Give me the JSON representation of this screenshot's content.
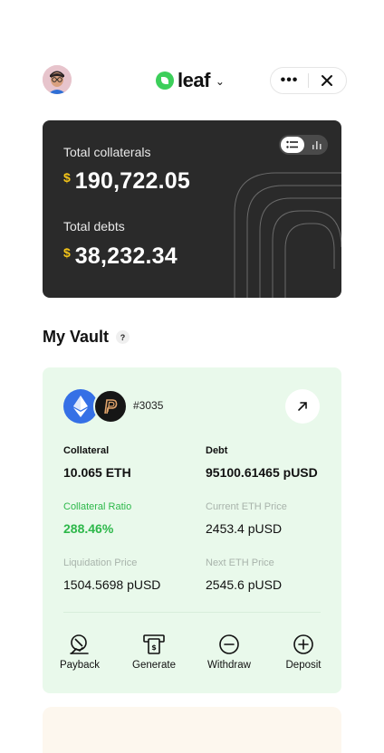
{
  "app": {
    "brand": "leaf",
    "chevron": "⌄",
    "more_label": "•••",
    "icons": {
      "avatar": "user-avatar",
      "logo": "leaf-logo-icon",
      "close": "close-icon"
    }
  },
  "summary": {
    "currency_symbol": "$",
    "total_collaterals_label": "Total collaterals",
    "total_collaterals_value": "190,722.05",
    "total_debts_label": "Total debts",
    "total_debts_value": "38,232.34",
    "view_toggle": {
      "active": "list",
      "options": [
        "list-icon",
        "bar-chart-icon"
      ]
    }
  },
  "vault_section": {
    "title": "My Vault",
    "help_label": "?"
  },
  "vault": {
    "id_label": "#3035",
    "fields": {
      "collateral_label": "Collateral",
      "collateral_value": "10.065 ETH",
      "debt_label": "Debt",
      "debt_value": "95100.61465 pUSD",
      "ratio_label": "Collateral Ratio",
      "ratio_value": "288.46%",
      "eth_price_label": "Current ETH Price",
      "eth_price_value": "2453.4 pUSD",
      "liquidation_label": "Liquidation Price",
      "liquidation_value": "1504.5698 pUSD",
      "next_price_label": "Next ETH Price",
      "next_price_value": "2545.6 pUSD"
    },
    "actions": {
      "payback": "Payback",
      "generate": "Generate",
      "withdraw": "Withdraw",
      "deposit": "Deposit"
    }
  },
  "colors": {
    "accent_green": "#2db84a",
    "card_bg": "#e9f9eb",
    "summary_bg": "#2a2a2a",
    "currency_yellow": "#f5c518",
    "eth_blue": "#3570e6"
  }
}
